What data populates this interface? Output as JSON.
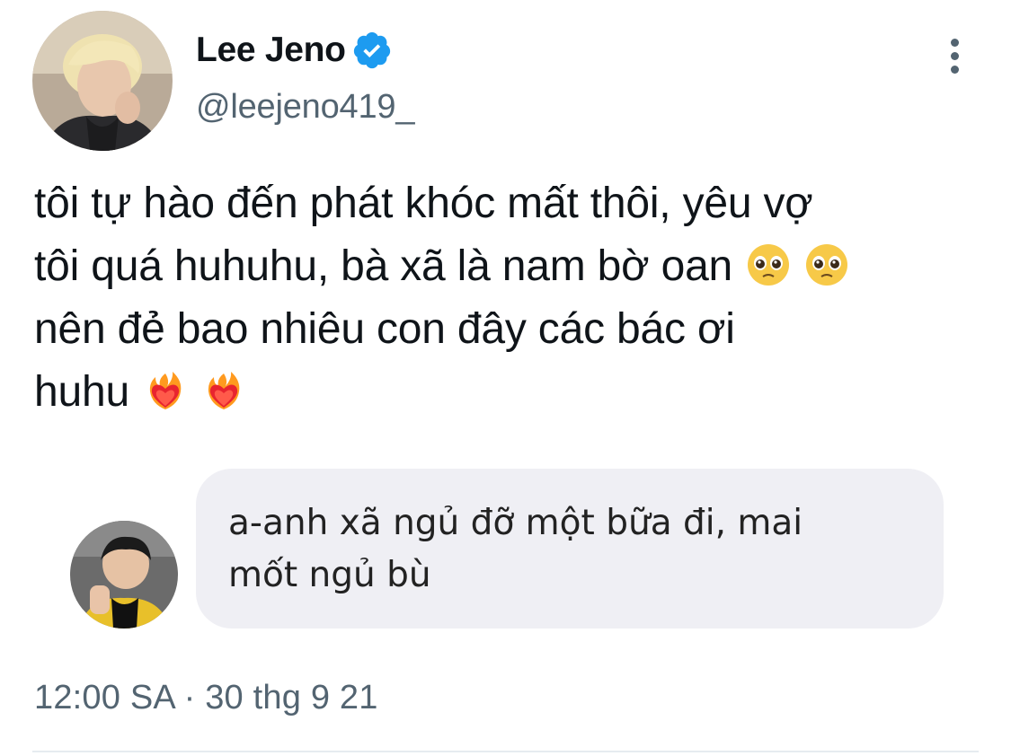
{
  "author": {
    "display_name": "Lee Jeno",
    "handle": "@leejeno419_",
    "verified": true,
    "avatar_icon": "profile-photo-blond-hair"
  },
  "tweet": {
    "text_lines": [
      "tôi tự hào đến phát khóc mất thôi, yêu vợ",
      "tôi quá huhuhu, bà xã là nam bờ oan",
      "nên đẻ bao nhiêu con đây các bác ơi",
      "huhu"
    ],
    "emojis_line2": [
      "pleading-face",
      "pleading-face"
    ],
    "emojis_line4": [
      "heart-on-fire",
      "heart-on-fire"
    ],
    "timestamp": "12:00 SA · 30 thg 9 21"
  },
  "reply_message": {
    "text_lines": [
      "a-anh xã ngủ đỡ một bữa đi, mai",
      "mốt ngủ bù"
    ],
    "avatar_icon": "profile-photo-raised-hand",
    "bubble_color": "#efeff4"
  },
  "colors": {
    "text_primary": "#0f1419",
    "text_secondary": "#536471",
    "verified_blue": "#1d9bf0"
  }
}
